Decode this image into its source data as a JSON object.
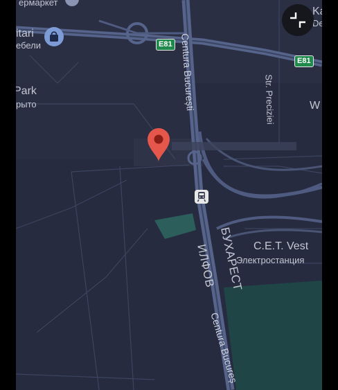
{
  "map": {
    "labels": {
      "supermarket_cyr": "ермаркет",
      "sitari": "itari",
      "mebeli_cyr": "ебели",
      "park": "Park",
      "park_cyr": "рыто",
      "centura_top": "Centura București",
      "centura_bottom": "Centura Bucureș",
      "str_precizie": "Str. Preciziei",
      "cet_vest": "C.E.T. Vest",
      "elektrostantsia": "Электростанция",
      "bukharest": "БУХАРЕСТ",
      "ilfov": "ИЛФОВ",
      "ka": "Ka",
      "de": "De",
      "w": "W"
    },
    "shields": {
      "e81_left": "E81",
      "e81_right": "E81"
    },
    "icons": {
      "collapse": "fullscreen-exit-icon",
      "pin": "map-pin-icon",
      "shop": "shopping-bag-icon",
      "rail": "train-station-icon"
    },
    "colors": {
      "land": "#262b3f",
      "urban": "#2f3346",
      "road": "#4a5575",
      "highway": "#5a6890",
      "water": "#1f4547",
      "park": "#2c5f5c",
      "pin": "#e4574a"
    }
  }
}
